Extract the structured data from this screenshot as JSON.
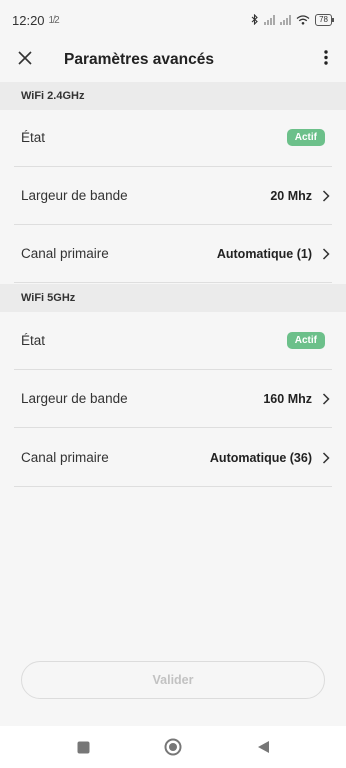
{
  "status_bar": {
    "time": "12:20",
    "extra": "1̸̶",
    "battery": "78"
  },
  "header": {
    "title": "Paramètres avancés"
  },
  "sections": [
    {
      "title": "WiFi 2.4GHz",
      "rows": [
        {
          "label": "État",
          "badge": "Actif"
        },
        {
          "label": "Largeur de bande",
          "value": "20 Mhz"
        },
        {
          "label": "Canal primaire",
          "value": "Automatique (1)"
        }
      ]
    },
    {
      "title": "WiFi 5GHz",
      "rows": [
        {
          "label": "État",
          "badge": "Actif"
        },
        {
          "label": "Largeur de bande",
          "value": "160 Mhz"
        },
        {
          "label": "Canal primaire",
          "value": "Automatique (36)"
        }
      ]
    }
  ],
  "footer": {
    "validate_label": "Valider"
  },
  "colors": {
    "badge_green": "#6cc08a",
    "background": "#f6f6f6",
    "section_bg": "#ebebeb"
  },
  "icons": [
    "close-icon",
    "more-vertical-icon",
    "chevron-right-icon",
    "bluetooth-icon",
    "signal-icon",
    "wifi-icon",
    "battery-icon",
    "nav-square-icon",
    "nav-circle-icon",
    "nav-back-icon"
  ]
}
